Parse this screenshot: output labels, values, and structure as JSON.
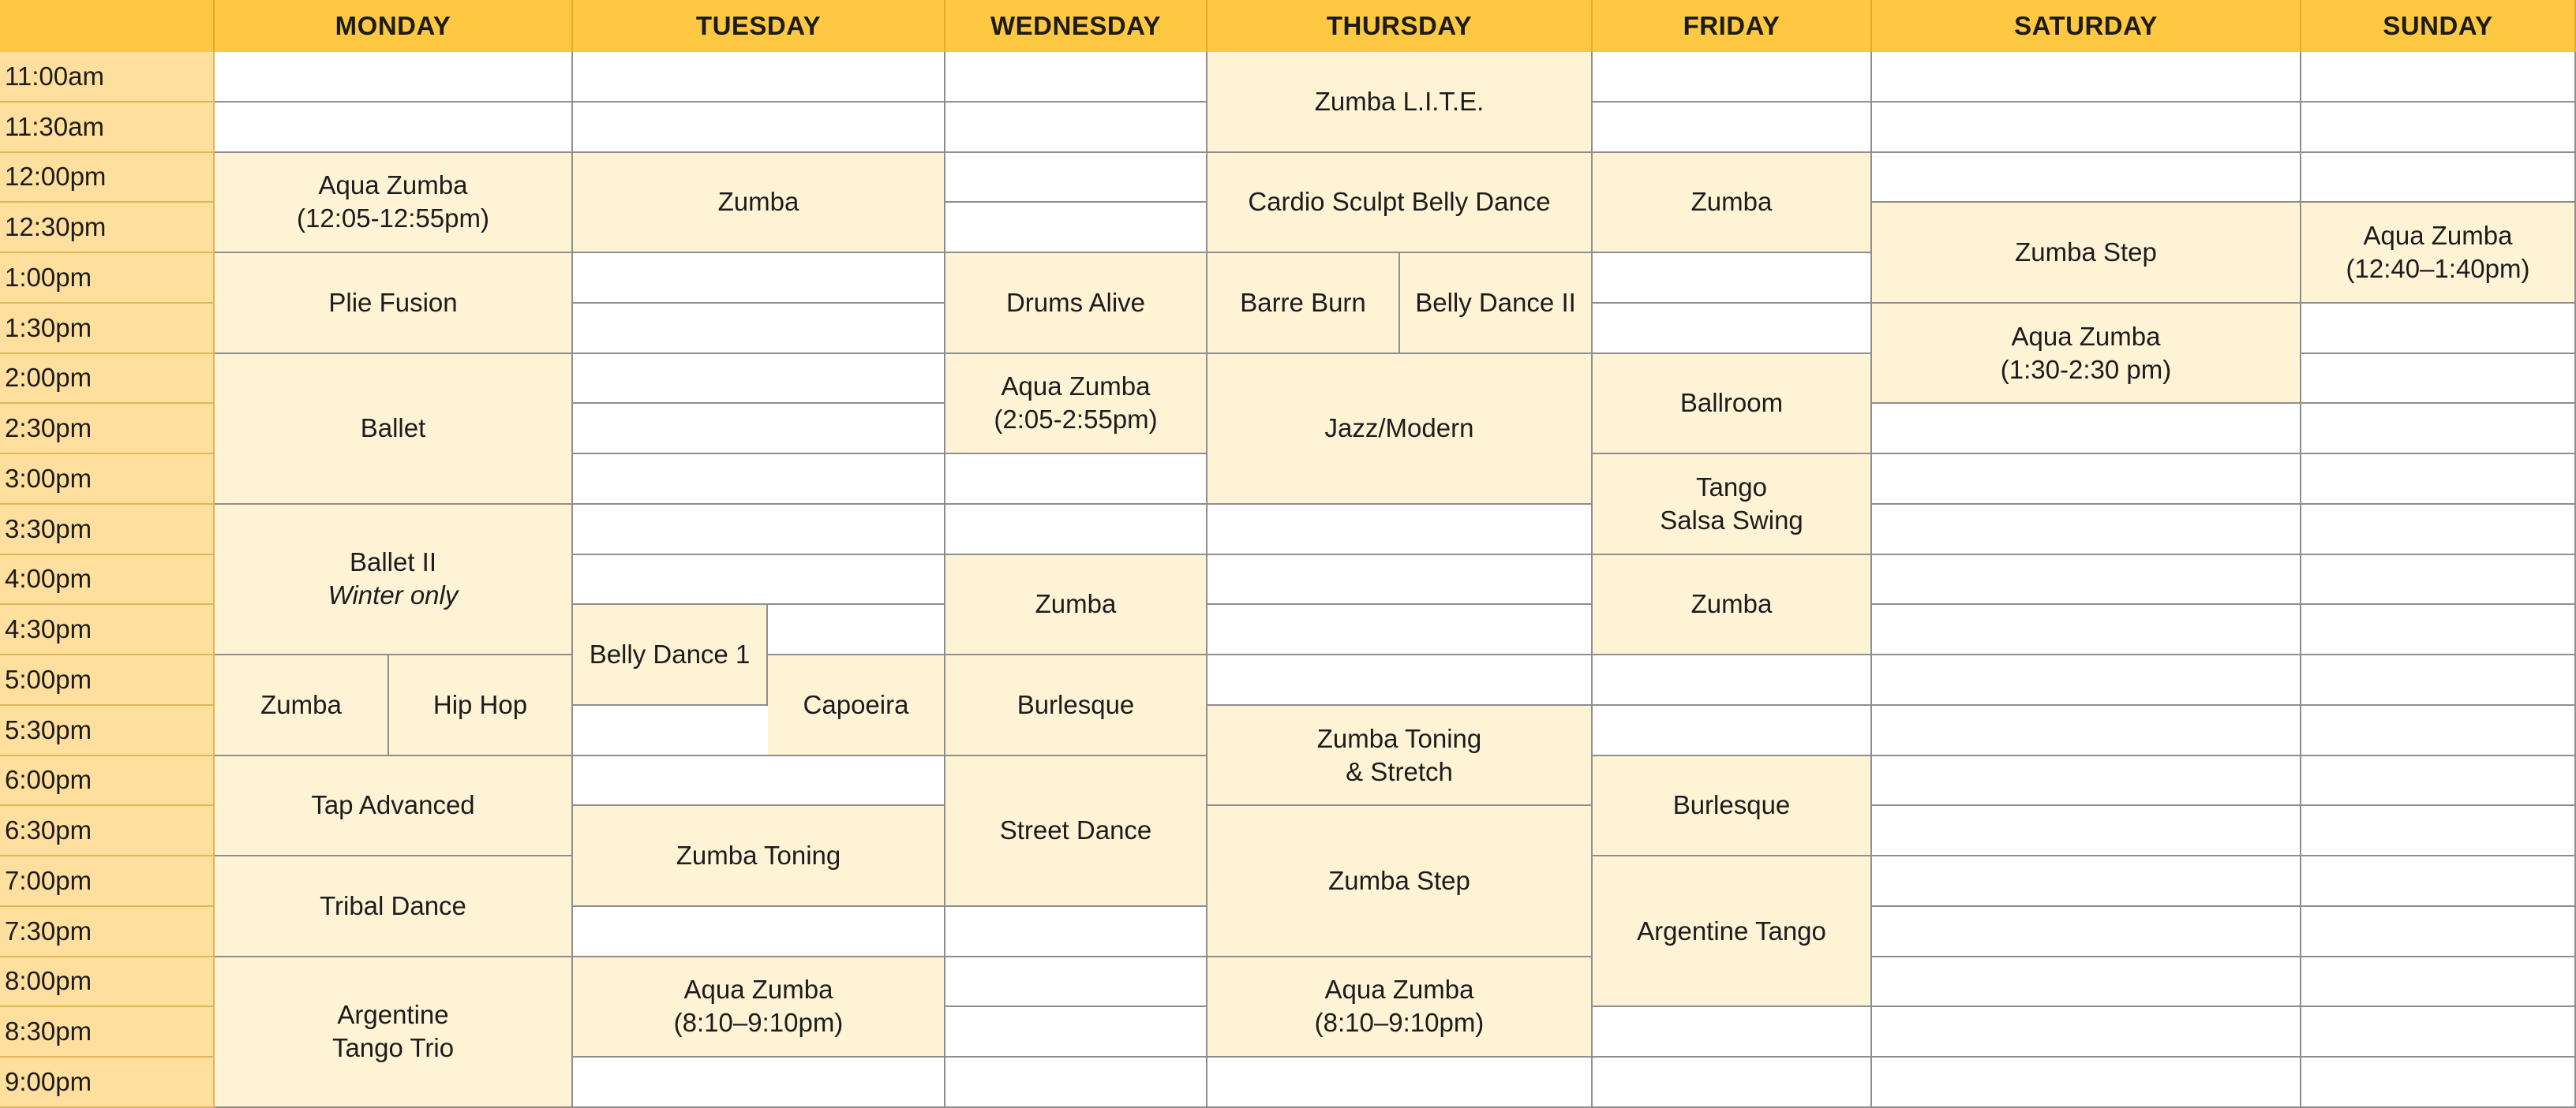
{
  "colors": {
    "header_bg": "#ffc843",
    "time_bg": "#ffdf9d",
    "event_bg": "#fff3d6",
    "empty_bg": "#ffffff",
    "grid_line": "#8e8e8e"
  },
  "corner": "",
  "days": [
    "MONDAY",
    "TUESDAY",
    "WEDNESDAY",
    "THURSDAY",
    "FRIDAY",
    "SATURDAY",
    "SUNDAY"
  ],
  "times": [
    "11:00am",
    "11:30am",
    "12:00pm",
    "12:30pm",
    "1:00pm",
    "1:30pm",
    "2:00pm",
    "2:30pm",
    "3:00pm",
    "3:30pm",
    "4:00pm",
    "4:30pm",
    "5:00pm",
    "5:30pm",
    "6:00pm",
    "6:30pm",
    "7:00pm",
    "7:30pm",
    "8:00pm",
    "8:30pm",
    "9:00pm"
  ],
  "events": [
    {
      "day": 0,
      "sub": "full",
      "start": 2,
      "span": 2,
      "lines": [
        "Aqua Zumba",
        "(12:05-12:55pm)"
      ]
    },
    {
      "day": 0,
      "sub": "full",
      "start": 4,
      "span": 2,
      "lines": [
        "Plie Fusion"
      ]
    },
    {
      "day": 0,
      "sub": "full",
      "start": 6,
      "span": 3,
      "lines": [
        "Ballet"
      ]
    },
    {
      "day": 0,
      "sub": "full",
      "start": 9,
      "span": 3,
      "lines": [
        "Ballet II"
      ],
      "note": "Winter only"
    },
    {
      "day": 0,
      "sub": "left",
      "start": 12,
      "span": 2,
      "lines": [
        "Zumba"
      ]
    },
    {
      "day": 0,
      "sub": "right",
      "start": 12,
      "span": 2,
      "lines": [
        "Hip Hop"
      ]
    },
    {
      "day": 0,
      "sub": "full",
      "start": 14,
      "span": 2,
      "lines": [
        "Tap Advanced"
      ]
    },
    {
      "day": 0,
      "sub": "full",
      "start": 16,
      "span": 2,
      "lines": [
        "Tribal Dance"
      ]
    },
    {
      "day": 0,
      "sub": "full",
      "start": 18,
      "span": 3,
      "lines": [
        "Argentine",
        "Tango Trio"
      ]
    },
    {
      "day": 1,
      "sub": "full",
      "start": 2,
      "span": 2,
      "lines": [
        "Zumba"
      ]
    },
    {
      "day": 1,
      "sub": "left",
      "start": 11,
      "span": 2,
      "lines": [
        "Belly Dance 1"
      ]
    },
    {
      "day": 1,
      "sub": "right",
      "start": 12,
      "span": 2,
      "lines": [
        "Capoeira"
      ]
    },
    {
      "day": 1,
      "sub": "full",
      "start": 15,
      "span": 2,
      "lines": [
        "Zumba Toning"
      ]
    },
    {
      "day": 1,
      "sub": "full",
      "start": 18,
      "span": 2,
      "lines": [
        "Aqua Zumba",
        "(8:10–9:10pm)"
      ]
    },
    {
      "day": 2,
      "sub": "full",
      "start": 4,
      "span": 2,
      "lines": [
        "Drums Alive"
      ]
    },
    {
      "day": 2,
      "sub": "full",
      "start": 6,
      "span": 2,
      "lines": [
        "Aqua Zumba",
        "(2:05-2:55pm)"
      ]
    },
    {
      "day": 2,
      "sub": "full",
      "start": 10,
      "span": 2,
      "lines": [
        "Zumba"
      ]
    },
    {
      "day": 2,
      "sub": "full",
      "start": 12,
      "span": 2,
      "lines": [
        "Burlesque"
      ]
    },
    {
      "day": 2,
      "sub": "full",
      "start": 14,
      "span": 3,
      "lines": [
        "Street Dance"
      ]
    },
    {
      "day": 3,
      "sub": "full",
      "start": 0,
      "span": 2,
      "lines": [
        "Zumba L.I.T.E."
      ]
    },
    {
      "day": 3,
      "sub": "full",
      "start": 2,
      "span": 2,
      "lines": [
        "Cardio Sculpt Belly Dance"
      ]
    },
    {
      "day": 3,
      "sub": "left",
      "start": 4,
      "span": 2,
      "lines": [
        "Barre Burn"
      ]
    },
    {
      "day": 3,
      "sub": "right",
      "start": 4,
      "span": 2,
      "lines": [
        "Belly Dance II"
      ]
    },
    {
      "day": 3,
      "sub": "full",
      "start": 6,
      "span": 3,
      "lines": [
        "Jazz/Modern"
      ]
    },
    {
      "day": 3,
      "sub": "full",
      "start": 13,
      "span": 2,
      "lines": [
        "Zumba Toning",
        "& Stretch"
      ]
    },
    {
      "day": 3,
      "sub": "full",
      "start": 15,
      "span": 3,
      "lines": [
        "Zumba Step"
      ]
    },
    {
      "day": 3,
      "sub": "full",
      "start": 18,
      "span": 2,
      "lines": [
        "Aqua Zumba",
        "(8:10–9:10pm)"
      ]
    },
    {
      "day": 4,
      "sub": "full",
      "start": 2,
      "span": 2,
      "lines": [
        "Zumba"
      ]
    },
    {
      "day": 4,
      "sub": "full",
      "start": 6,
      "span": 2,
      "lines": [
        "Ballroom"
      ]
    },
    {
      "day": 4,
      "sub": "full",
      "start": 8,
      "span": 2,
      "lines": [
        "Tango",
        "Salsa Swing"
      ]
    },
    {
      "day": 4,
      "sub": "full",
      "start": 10,
      "span": 2,
      "lines": [
        "Zumba"
      ]
    },
    {
      "day": 4,
      "sub": "full",
      "start": 14,
      "span": 2,
      "lines": [
        "Burlesque"
      ]
    },
    {
      "day": 4,
      "sub": "full",
      "start": 16,
      "span": 3,
      "lines": [
        "Argentine Tango"
      ]
    },
    {
      "day": 5,
      "sub": "full",
      "start": 3,
      "span": 2,
      "lines": [
        "Zumba Step"
      ]
    },
    {
      "day": 5,
      "sub": "full",
      "start": 5,
      "span": 2,
      "lines": [
        "Aqua Zumba",
        "(1:30-2:30 pm)"
      ]
    },
    {
      "day": 6,
      "sub": "full",
      "start": 3,
      "span": 2,
      "lines": [
        "Aqua Zumba",
        "(12:40–1:40pm)"
      ]
    }
  ]
}
